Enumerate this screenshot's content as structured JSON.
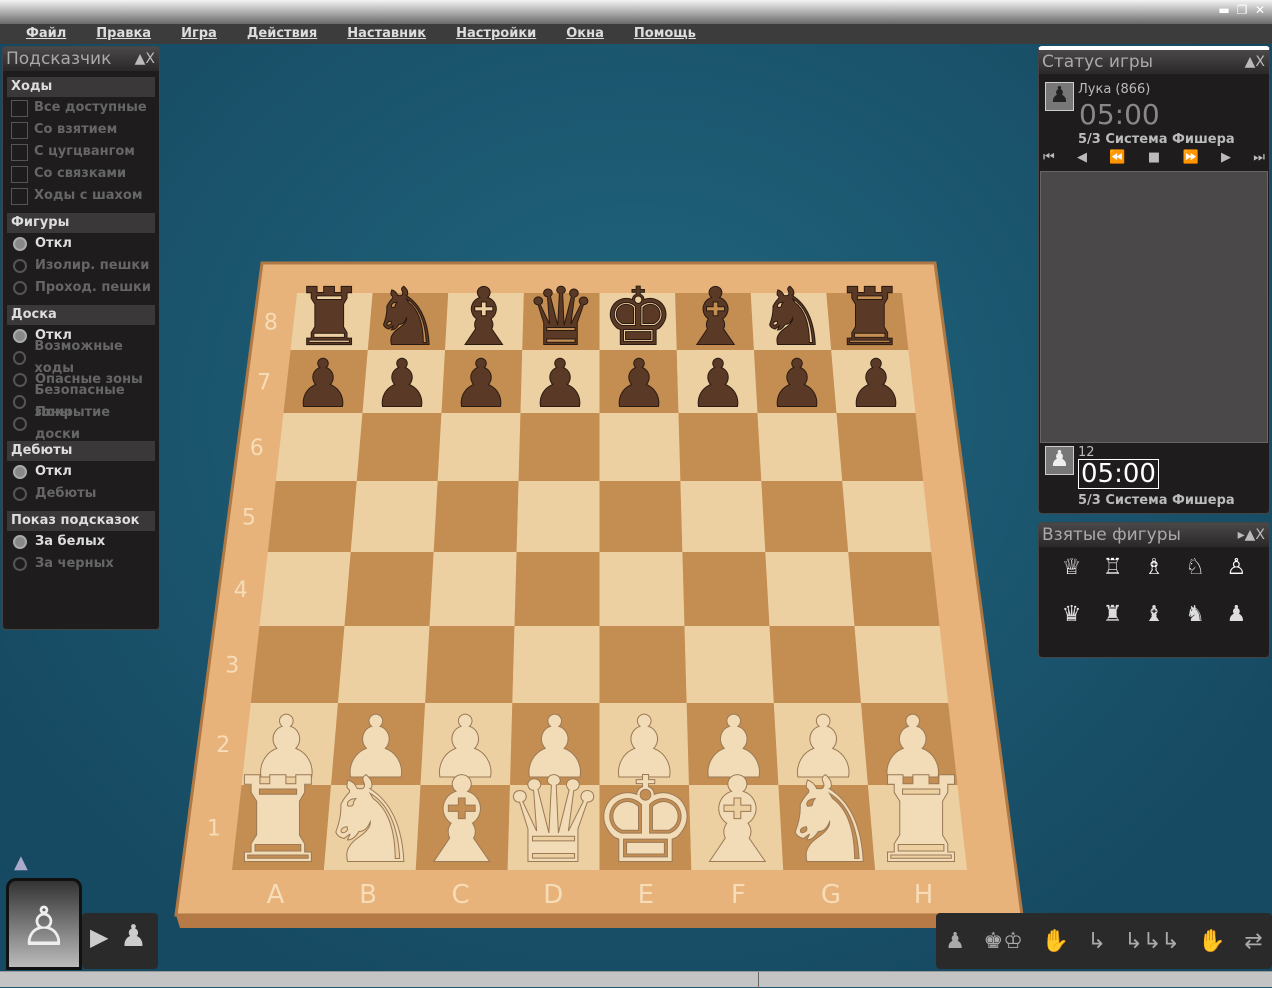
{
  "menu": [
    "Файл",
    "Правка",
    "Игра",
    "Действия",
    "Наставник",
    "Настройки",
    "Окна",
    "Помощь"
  ],
  "hint_panel": {
    "title": "Подсказчик",
    "moves": {
      "header": "Ходы",
      "items": [
        "Все доступные",
        "Со взятием",
        "С цугцвангом",
        "Со связками",
        "Ходы с шахом"
      ]
    },
    "pieces": {
      "header": "Фигуры",
      "items": [
        "Откл",
        "Изолир. пешки",
        "Проход. пешки"
      ],
      "selected": 0
    },
    "board": {
      "header": "Доска",
      "items": [
        "Откл",
        "Возможные ходы",
        "Опасные зоны",
        "Безопасные зоны",
        "Покрытие доски"
      ],
      "selected": 0
    },
    "openings": {
      "header": "Дебюты",
      "items": [
        "Откл",
        "Дебюты"
      ],
      "selected": 0
    },
    "show": {
      "header": "Показ подсказок",
      "items": [
        "За белых",
        "За черных"
      ],
      "selected": 0
    }
  },
  "status_panel": {
    "title": "Статус игры",
    "top_player": {
      "name": "Лука (866)",
      "clock": "05:00",
      "mode": "5/3 Система Фишера"
    },
    "bottom_player": {
      "name": "12",
      "clock": "05:00",
      "mode": "5/3 Система Фишера"
    },
    "nav": [
      "⏮",
      "◀",
      "⏪",
      "■",
      "⏩",
      "▶",
      "⏭"
    ]
  },
  "captured_panel": {
    "title": "Взятые фигуры",
    "white": [
      "♕",
      "♖",
      "♗",
      "♘",
      "♙"
    ],
    "black": [
      "♛",
      "♜",
      "♝",
      "♞",
      "♟"
    ]
  },
  "board": {
    "files": [
      "A",
      "B",
      "C",
      "D",
      "E",
      "F",
      "G",
      "H"
    ],
    "ranks": [
      "8",
      "7",
      "6",
      "5",
      "4",
      "3",
      "2",
      "1"
    ],
    "position": [
      "rnbqkbnr",
      "pppppppp",
      "........",
      "........",
      "........",
      "........",
      "PPPPPPPP",
      "RNBQKBNR"
    ]
  },
  "colors": {
    "light": "#ecd0a2",
    "dark": "#c48d52",
    "frame": "#e7b37a",
    "white_piece": "#f2dcb8",
    "black_piece": "#5a3a26"
  },
  "toolbar": [
    "♟",
    "♚♔",
    "✋",
    "↳",
    "↳↳↳",
    "✋",
    "⇄"
  ]
}
